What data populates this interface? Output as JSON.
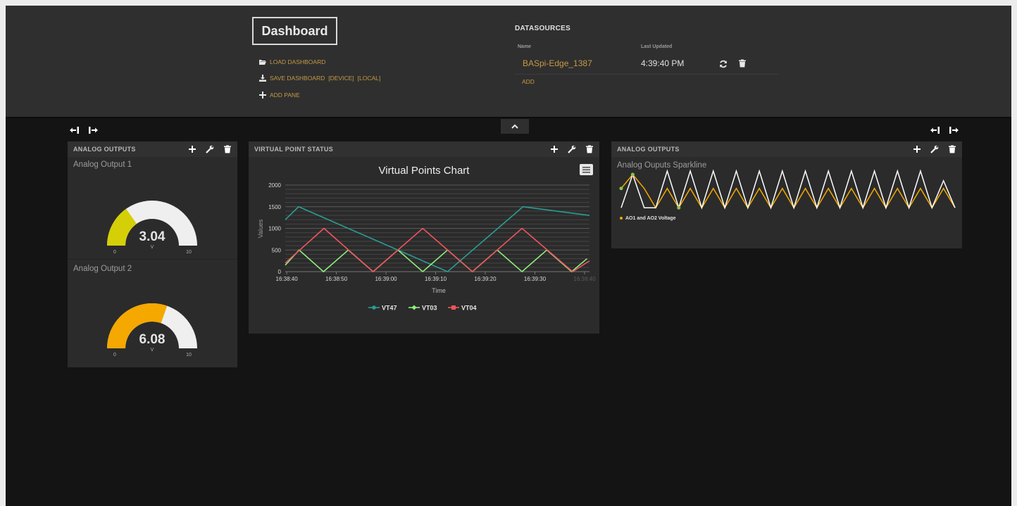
{
  "header": {
    "title": "Dashboard",
    "menu": {
      "load": "LOAD DASHBOARD",
      "save": "SAVE DASHBOARD",
      "save_device": "[DEVICE]",
      "save_local": "[LOCAL]",
      "add_pane": "ADD PANE"
    },
    "datasources": {
      "title": "DATASOURCES",
      "col_name": "Name",
      "col_updated": "Last Updated",
      "rows": [
        {
          "name": "BASpi-Edge_1387",
          "updated": "4:39:40 PM"
        }
      ],
      "add": "ADD"
    }
  },
  "panes": {
    "left": {
      "title": "ANALOG OUTPUTS",
      "gauges": [
        {
          "title": "Analog Output 1",
          "value": "3.04",
          "numeric": 3.04,
          "unit": "V",
          "min": "0",
          "max": "10",
          "color": "#d5cf08"
        },
        {
          "title": "Analog Output 2",
          "value": "6.08",
          "numeric": 6.08,
          "unit": "V",
          "min": "0",
          "max": "10",
          "color": "#f4a800"
        }
      ]
    },
    "middle": {
      "title": "VIRTUAL POINT STATUS"
    },
    "right": {
      "title": "ANALOG OUTPUTS",
      "sparkline_title": "Analog Ouputs Sparkline",
      "legend": "AO1 and AO2 Voltage"
    }
  },
  "chart_data": [
    {
      "type": "line",
      "title": "Virtual Points Chart",
      "xlabel": "Time",
      "ylabel": "Values",
      "ylim": [
        0,
        2000
      ],
      "y_ticks": [
        "0",
        "500",
        "1000",
        "1500",
        "2000"
      ],
      "x_ticks": [
        "16:38:40",
        "16:38:50",
        "16:39:00",
        "16:39:10",
        "16:39:20",
        "16:39:30",
        "16:39:40"
      ],
      "x_range": [
        -0.3,
        61
      ],
      "grid": true,
      "legend_position": "bottom",
      "series": [
        {
          "name": "VT47",
          "color": "#2a9d92",
          "marker": "circle",
          "x": [
            -0.3,
            2.4,
            32.4,
            47.6,
            61
          ],
          "y": [
            1200,
            1500,
            0,
            1500,
            1300
          ]
        },
        {
          "name": "VT03",
          "color": "#8fee7c",
          "marker": "diamond",
          "x": [
            -0.3,
            2.5,
            7.4,
            12.4,
            17.4,
            22.4,
            27.4,
            32.4,
            37.4,
            42.4,
            47.4,
            52.4,
            57.4,
            60.5
          ],
          "y": [
            150,
            500,
            0,
            500,
            0,
            500,
            0,
            500,
            0,
            500,
            0,
            500,
            0,
            300
          ]
        },
        {
          "name": "VT04",
          "color": "#f1545d",
          "marker": "square",
          "x": [
            -0.3,
            7.5,
            17.4,
            27.4,
            37.4,
            47.4,
            57.6,
            61
          ],
          "y": [
            200,
            1000,
            0,
            1000,
            0,
            1000,
            0,
            250
          ]
        }
      ]
    },
    {
      "type": "line",
      "title": "Analog Ouputs Sparkline",
      "legend": "AO1 and AO2 Voltage",
      "series": [
        {
          "name": "AO1",
          "color": "#f4a800",
          "y": [
            0.55,
            0.91,
            0.55,
            0.05,
            0.55,
            0.05,
            0.55,
            0.05,
            0.55,
            0.05,
            0.55,
            0.05,
            0.55,
            0.05,
            0.55,
            0.05,
            0.55,
            0.05,
            0.55,
            0.05,
            0.55,
            0.05,
            0.55,
            0.05,
            0.55,
            0.05,
            0.55,
            0.05,
            0.55,
            0.05
          ]
        },
        {
          "name": "AO2",
          "color": "#ffffff",
          "y": [
            0.05,
            0.91,
            0.05,
            0.05,
            1.0,
            0.05,
            1.0,
            0.05,
            1.0,
            0.05,
            1.0,
            0.05,
            1.0,
            0.05,
            1.0,
            0.05,
            1.0,
            0.05,
            1.0,
            0.05,
            1.0,
            0.05,
            1.0,
            0.05,
            1.0,
            0.05,
            1.0,
            0.05,
            0.75,
            0.05
          ]
        }
      ]
    }
  ]
}
